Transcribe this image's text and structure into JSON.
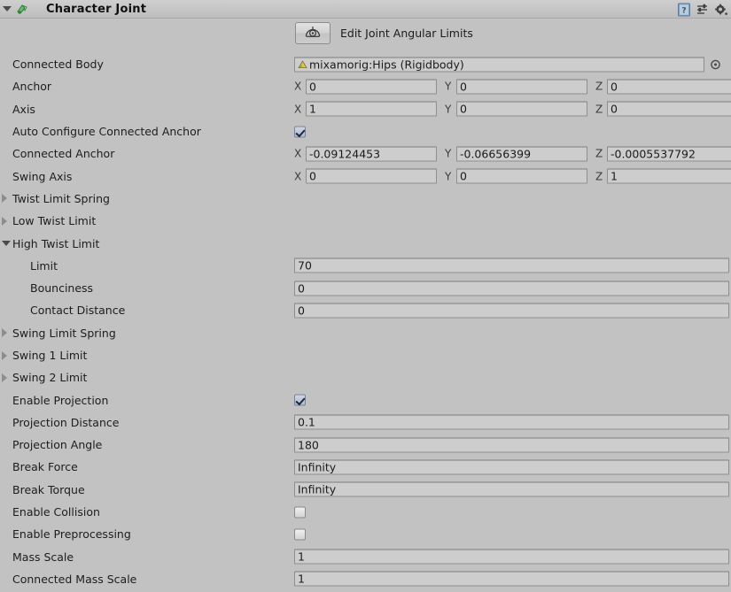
{
  "header": {
    "title": "Character Joint",
    "foldout_state": "expanded",
    "icons": [
      {
        "name": "help-icon",
        "label": "?"
      },
      {
        "name": "preset-icon",
        "label": "presets"
      },
      {
        "name": "context-menu-icon",
        "label": "settings"
      }
    ]
  },
  "edit_tool": {
    "icon_name": "joint-angular-limits-icon",
    "label": "Edit Joint Angular Limits"
  },
  "colors": {
    "background": "#c2c2c2",
    "field_fill": "#cdcdcd",
    "field_border": "#8e8e8e",
    "checkbox_on": "#1c2740",
    "header_gradient_top": "#cfcfcf"
  },
  "properties": {
    "connected_body": {
      "label": "Connected Body",
      "value": "mixamorig:Hips (Rigidbody)",
      "icon_name": "rigidbody-object-icon"
    },
    "anchor": {
      "label": "Anchor",
      "x_label": "X",
      "y_label": "Y",
      "z_label": "Z",
      "x": "0",
      "y": "0",
      "z": "0"
    },
    "axis": {
      "label": "Axis",
      "x_label": "X",
      "y_label": "Y",
      "z_label": "Z",
      "x": "1",
      "y": "0",
      "z": "0"
    },
    "auto_configure_connected_anchor": {
      "label": "Auto Configure Connected Anchor",
      "checked": true
    },
    "connected_anchor": {
      "label": "Connected Anchor",
      "x_label": "X",
      "y_label": "Y",
      "z_label": "Z",
      "x": "-0.09124453",
      "y": "-0.06656399",
      "z": "-0.0005537792"
    },
    "swing_axis": {
      "label": "Swing Axis",
      "x_label": "X",
      "y_label": "Y",
      "z_label": "Z",
      "x": "0",
      "y": "0",
      "z": "1"
    },
    "twist_limit_spring": {
      "label": "Twist Limit Spring",
      "expanded": false
    },
    "low_twist_limit": {
      "label": "Low Twist Limit",
      "expanded": false
    },
    "high_twist_limit": {
      "label": "High Twist Limit",
      "expanded": true,
      "children": {
        "limit": {
          "label": "Limit",
          "value": "70"
        },
        "bounciness": {
          "label": "Bounciness",
          "value": "0"
        },
        "contact_distance": {
          "label": "Contact Distance",
          "value": "0"
        }
      }
    },
    "swing_limit_spring": {
      "label": "Swing Limit Spring",
      "expanded": false
    },
    "swing_1_limit": {
      "label": "Swing 1 Limit",
      "expanded": false
    },
    "swing_2_limit": {
      "label": "Swing 2 Limit",
      "expanded": false
    },
    "enable_projection": {
      "label": "Enable Projection",
      "checked": true
    },
    "projection_distance": {
      "label": "Projection Distance",
      "value": "0.1"
    },
    "projection_angle": {
      "label": "Projection Angle",
      "value": "180"
    },
    "break_force": {
      "label": "Break Force",
      "value": "Infinity"
    },
    "break_torque": {
      "label": "Break Torque",
      "value": "Infinity"
    },
    "enable_collision": {
      "label": "Enable Collision",
      "checked": false
    },
    "enable_preprocessing": {
      "label": "Enable Preprocessing",
      "checked": false
    },
    "mass_scale": {
      "label": "Mass Scale",
      "value": "1"
    },
    "connected_mass_scale": {
      "label": "Connected Mass Scale",
      "value": "1"
    }
  }
}
